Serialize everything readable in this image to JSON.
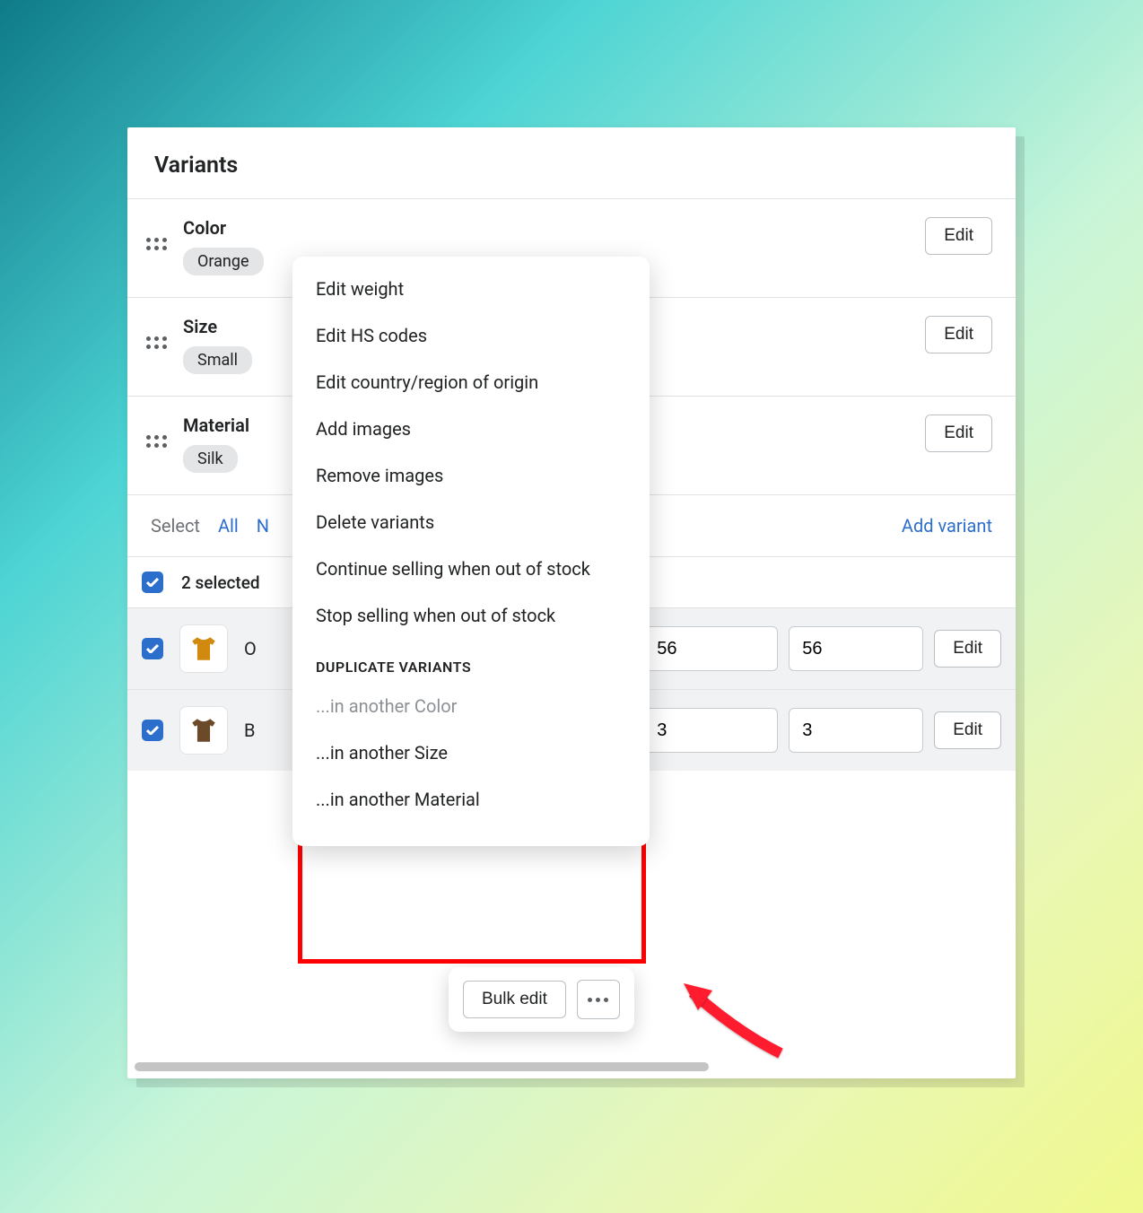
{
  "panel": {
    "title": "Variants",
    "options": [
      {
        "name": "Color",
        "chip": "Orange",
        "edit": "Edit"
      },
      {
        "name": "Size",
        "chip": "Small",
        "edit": "Edit"
      },
      {
        "name": "Material",
        "chip": "Silk",
        "edit": "Edit"
      }
    ],
    "select_row": {
      "label": "Select",
      "all": "All",
      "none_letter": "N",
      "add": "Add variant"
    },
    "selected_text": "2 selected",
    "variants": [
      {
        "label_first": "O",
        "val1": "56",
        "val2": "56",
        "edit": "Edit",
        "shirt_color": "#d18a0f"
      },
      {
        "label_first": "B",
        "val1": "3",
        "val2": "3",
        "edit": "Edit",
        "shirt_color": "#6b4a2a"
      }
    ]
  },
  "popover": {
    "items_top": [
      "Edit weight",
      "Edit HS codes",
      "Edit country/region of origin",
      "Add images",
      "Remove images",
      "Delete variants",
      "Continue selling when out of stock",
      "Stop selling when out of stock"
    ],
    "section_title": "DUPLICATE VARIANTS",
    "dup_items": [
      {
        "label": "...in another Color",
        "disabled": true
      },
      {
        "label": "...in another Size",
        "disabled": false
      },
      {
        "label": "...in another Material",
        "disabled": false
      }
    ]
  },
  "toolbar": {
    "bulk_edit": "Bulk edit"
  }
}
